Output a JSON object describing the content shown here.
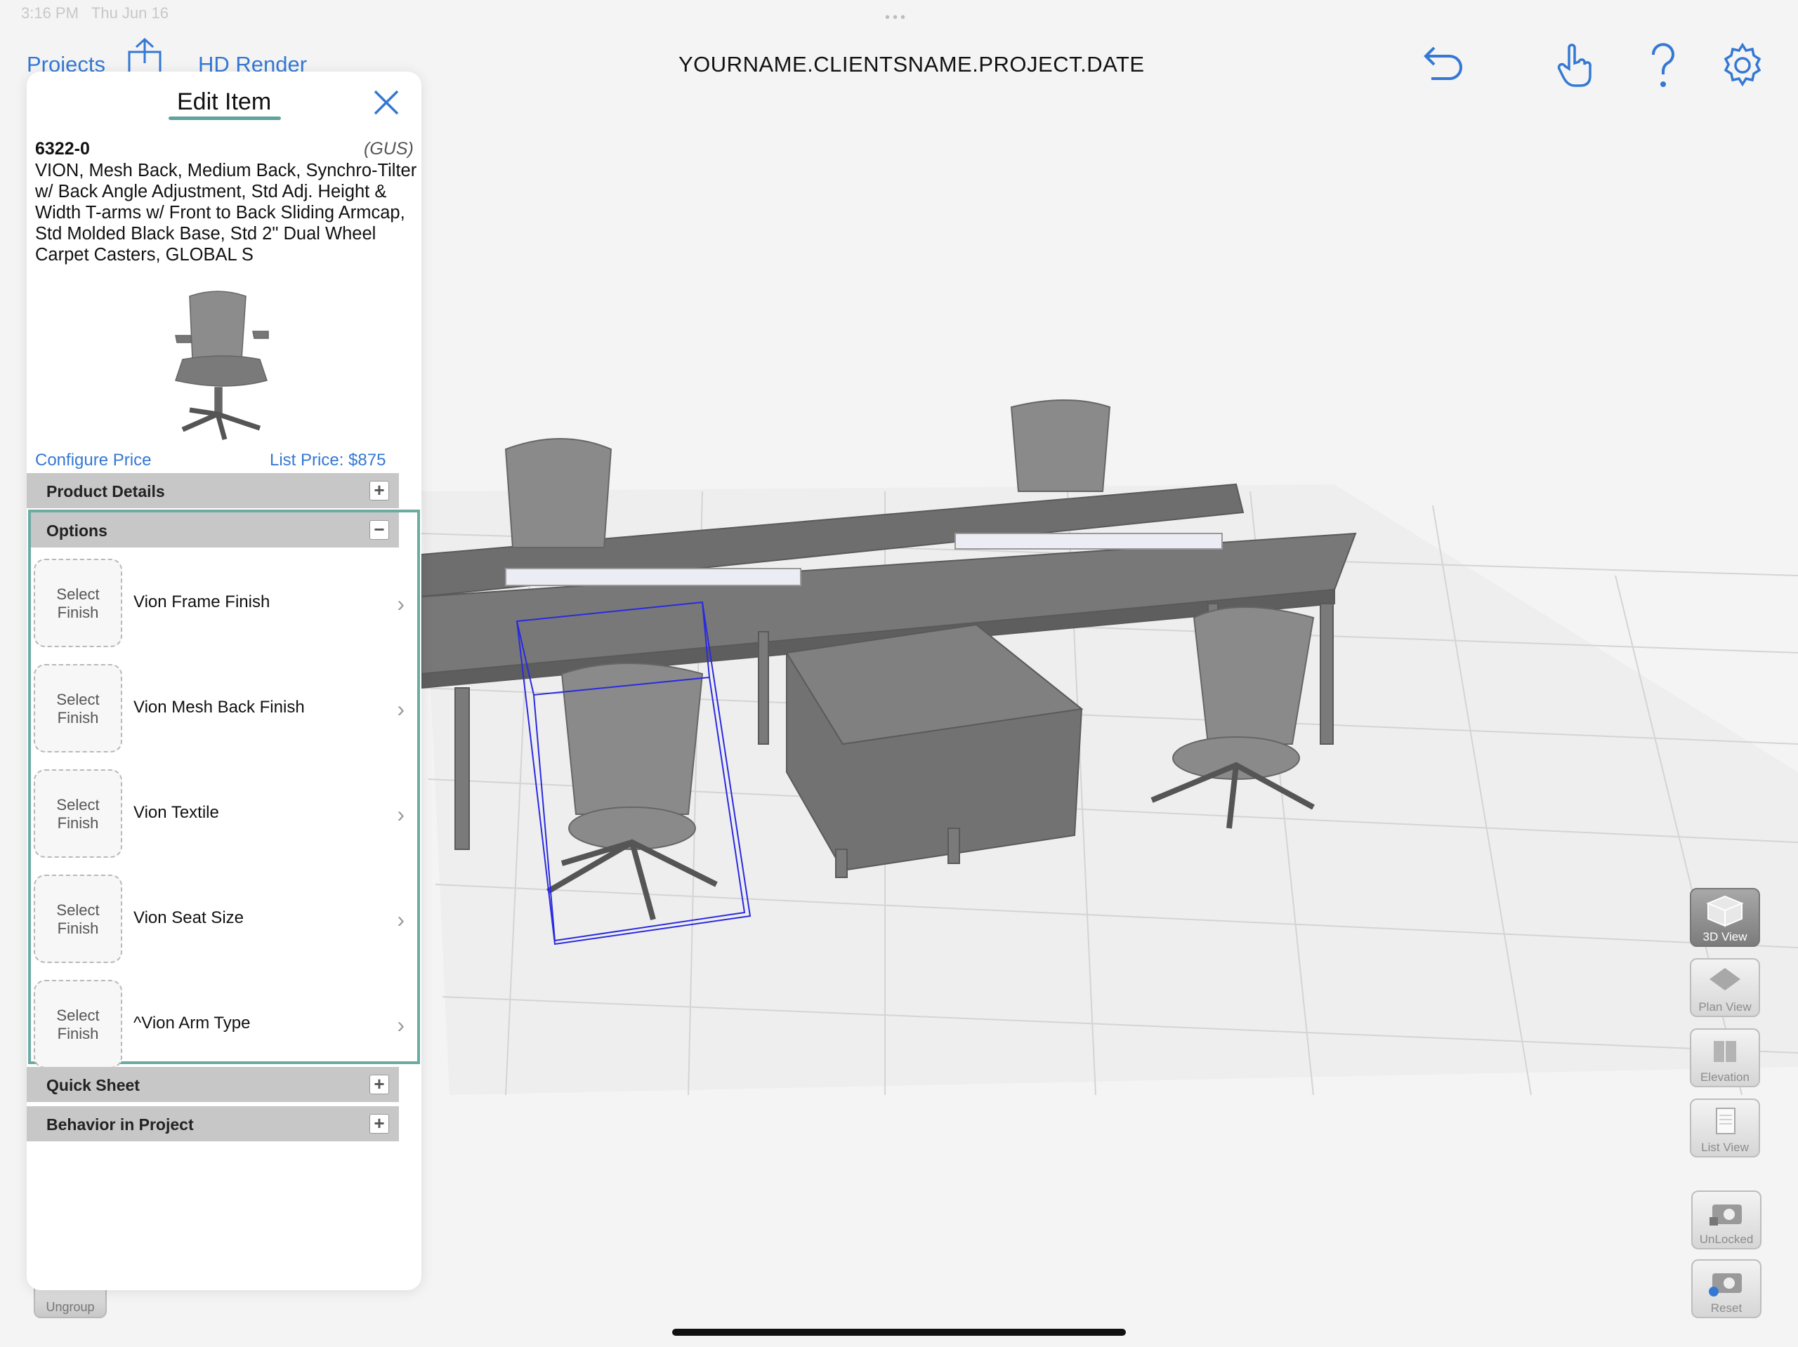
{
  "status_bar": {
    "time": "3:16 PM",
    "date": "Thu Jun 16"
  },
  "nav": {
    "projects": "Projects",
    "hd_render": "HD Render",
    "title": "YOURNAME.CLIENTSNAME.PROJECT.DATE",
    "icons": [
      "share-icon",
      "undo-icon",
      "hand-pointer-icon",
      "help-icon",
      "gear-icon"
    ]
  },
  "edit_item": {
    "title": "Edit Item",
    "sku": "6322-0",
    "brand": "(GUS)",
    "description": "VION, Mesh Back, Medium Back, Synchro-Tilter w/ Back Angle Adjustment, Std Adj. Height & Width T-arms w/ Front to Back Sliding Armcap, Std Molded Black Base, Std 2\" Dual Wheel Carpet Casters, GLOBAL S",
    "configure_price": "Configure Price",
    "list_price": "List Price: $875",
    "sections": {
      "product_details": "Product Details",
      "options": "Options",
      "quick_sheet": "Quick Sheet",
      "behavior": "Behavior in Project"
    },
    "swatch_text": "Select Finish",
    "options": [
      {
        "label": "Vion Frame Finish"
      },
      {
        "label": "Vion Mesh Back Finish"
      },
      {
        "label": "Vion Textile"
      },
      {
        "label": "Vion Seat Size"
      },
      {
        "label": "^Vion Arm Type"
      }
    ]
  },
  "toolbar": {
    "view_3d": "3D View",
    "plan_view": "Plan View",
    "elevation": "Elevation",
    "list_view": "List View",
    "unlocked": "UnLocked",
    "reset": "Reset",
    "ungroup": "Ungroup"
  },
  "colors": {
    "accent": "#3478d4",
    "options_border": "#6aaba2",
    "selection_box": "#2a2ae0"
  }
}
